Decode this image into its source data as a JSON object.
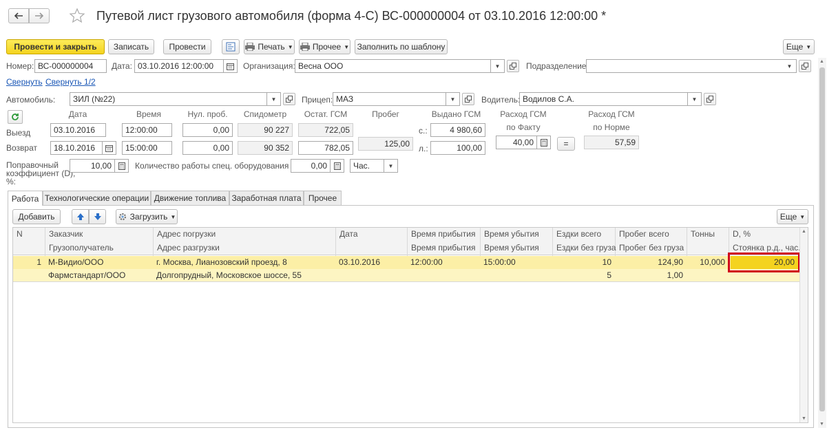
{
  "window": {
    "title": "Путевой лист грузового автомобиля (форма 4-С) ВС-000000004 от 03.10.2016 12:00:00 *"
  },
  "toolbar": {
    "post_close": "Провести и закрыть",
    "save": "Записать",
    "post": "Провести",
    "print": "Печать",
    "other": "Прочее",
    "fill_template": "Заполнить по шаблону",
    "more": "Еще"
  },
  "header": {
    "number_label": "Номер:",
    "number_value": "ВС-000000004",
    "date_label": "Дата:",
    "date_value": "03.10.2016 12:00:00",
    "org_label": "Организация:",
    "org_value": "Весна ООО",
    "dept_label": "Подразделение:",
    "dept_value": "",
    "collapse_link": "Свернуть",
    "collapse_half_link": "Свернуть 1/2"
  },
  "vehicle": {
    "car_label": "Автомобиль:",
    "car_value": "ЗИЛ (№22)",
    "trailer_label": "Прицеп:",
    "trailer_value": "МАЗ",
    "driver_label": "Водитель:",
    "driver_value": "Водилов С.А."
  },
  "trip": {
    "col_date": "Дата",
    "col_time": "Время",
    "col_zero": "Нул. проб.",
    "col_odometer": "Спидометр",
    "col_fuel_rest": "Остат. ГСМ",
    "col_mileage": "Пробег",
    "col_fuel_issued": "Выдано ГСМ",
    "col_fact_1": "Расход ГСМ",
    "col_fact_2": "по Факту",
    "col_norm_1": "Расход ГСМ",
    "col_norm_2": "по Норме",
    "row_depart": "Выезд",
    "row_return": "Возврат",
    "depart_date": "03.10.2016",
    "depart_time": "12:00:00",
    "depart_zero": "0,00",
    "depart_odometer": "90 227",
    "depart_fuel": "722,05",
    "return_date": "18.10.2016",
    "return_time": "15:00:00",
    "return_zero": "0,00",
    "return_odometer": "90 352",
    "return_fuel": "782,05",
    "mileage": "125,00",
    "issued_s_label": "с.:",
    "issued_s": "4 980,60",
    "issued_l_label": "л.:",
    "issued_l": "100,00",
    "fact": "40,00",
    "equals": "=",
    "norm": "57,59",
    "coef_label_1": "Поправочный",
    "coef_label_2": "коэффициент (D),",
    "coef_label_3": "%:",
    "coef_value": "10,00",
    "special_label": "Количество работы спец. оборудования (Т):",
    "special_value": "0,00",
    "unit_value": "Час."
  },
  "tabs": [
    "Работа",
    "Технологические операции",
    "Движение топлива",
    "Заработная плата",
    "Прочее"
  ],
  "work": {
    "add_button": "Добавить",
    "load_button": "Загрузить",
    "more": "Еще",
    "headers_row1": [
      "N",
      "Заказчик",
      "Адрес погрузки",
      "Дата",
      "Время прибытия",
      "Время убытия",
      "Ездки всего",
      "Пробег всего",
      "Тонны",
      "D, %"
    ],
    "headers_row2": [
      "",
      "Грузополучатель",
      "Адрес разгрузки",
      "",
      "Время прибытия",
      "Время убытия",
      "Ездки без груза",
      "Пробег без груза",
      "",
      "Стоянка р.д., час."
    ],
    "rows": [
      {
        "n": "1",
        "customer": "М-Видио/ООО",
        "load_address": "г. Москва, Лианозовский проезд, 8",
        "date": "03.10.2016",
        "arrive": "12:00:00",
        "depart": "15:00:00",
        "trips": "10",
        "mileage": "124,90",
        "tons": "10,000",
        "d_percent": "20,00",
        "consignee": "Фармстандарт/ООО",
        "unload_address": "Долгопрудный, Московское шоссе, 55",
        "trips_empty": "5",
        "mileage_empty": "1,00"
      }
    ]
  },
  "colors": {
    "accent_yellow": "#f7dc3b",
    "row_highlight": "#fdf5c2",
    "row_highlight_2": "#fcefa6",
    "red_frame": "#d0021b",
    "link_blue": "#1a57b6"
  }
}
